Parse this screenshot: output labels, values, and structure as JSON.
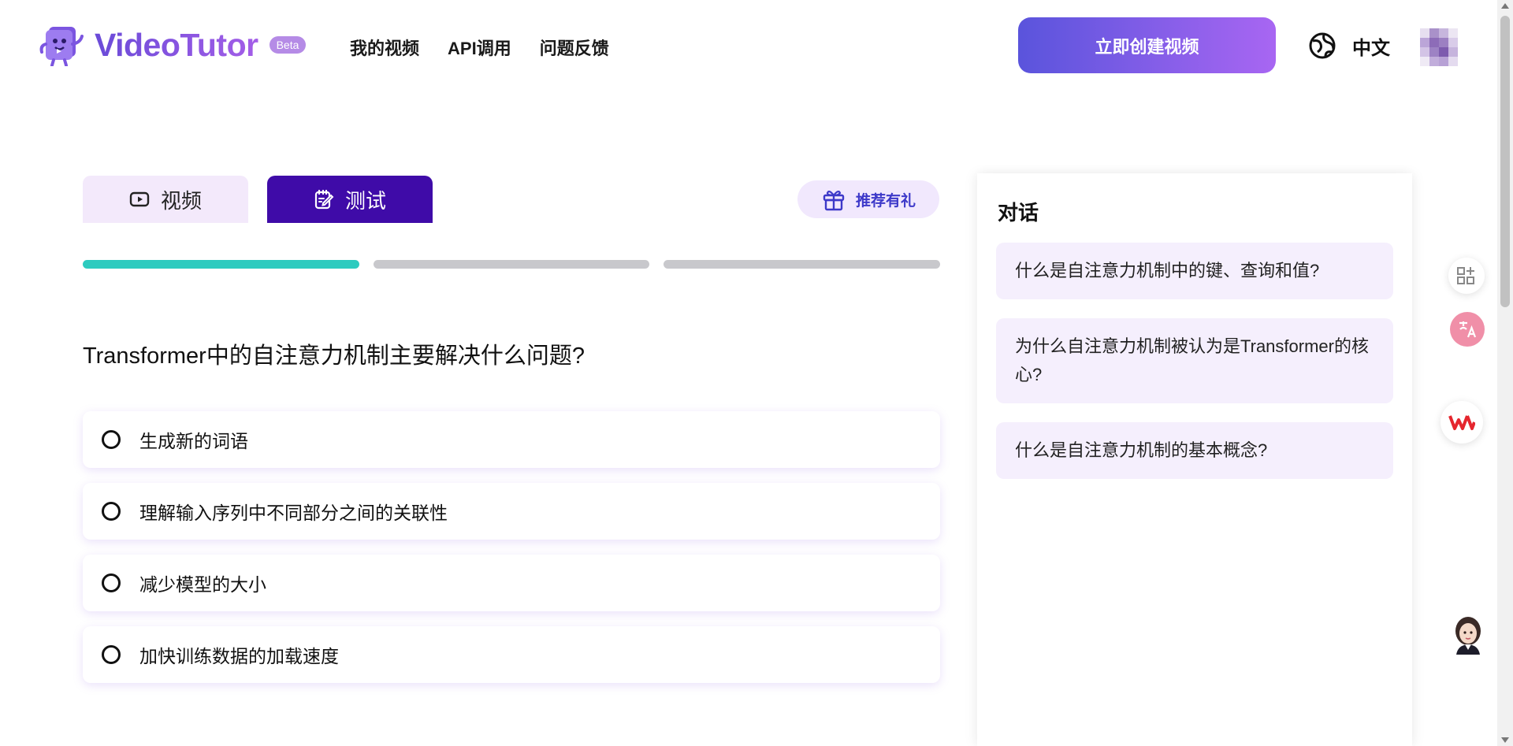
{
  "header": {
    "brand": "VideoTutor",
    "badge": "Beta",
    "nav": [
      "我的视频",
      "API调用",
      "问题反馈"
    ],
    "create_button": "立即创建视频",
    "language": "中文"
  },
  "tabs": {
    "video": "视频",
    "test": "测试",
    "active": "test"
  },
  "referral_button": "推荐有礼",
  "progress": {
    "total": 3,
    "current": 1
  },
  "quiz": {
    "question": "Transformer中的自注意力机制主要解决什么问题?",
    "options": [
      "生成新的词语",
      "理解输入序列中不同部分之间的关联性",
      "减少模型的大小",
      "加快训练数据的加载速度"
    ]
  },
  "chat": {
    "title": "对话",
    "suggestions": [
      "什么是自注意力机制中的键、查询和值?",
      "为什么自注意力机制被认为是Transformer的核心?",
      "什么是自注意力机制的基本概念?"
    ]
  },
  "icons": {
    "logo": "book-mascot-icon",
    "language": "globe-icon",
    "video_tab": "play-icon",
    "test_tab": "edit-note-icon",
    "referral": "gift-icon",
    "apps": "apps-add-icon",
    "translate": "translate-icon",
    "wps": "wps-icon",
    "assistant": "assistant-avatar-icon"
  },
  "colors": {
    "primary": "#3f0ba8",
    "accent_gradient_start": "#5a54dc",
    "accent_gradient_end": "#a866f2",
    "progress_active": "#2dcbbf",
    "chip_bg": "#f5effd"
  }
}
